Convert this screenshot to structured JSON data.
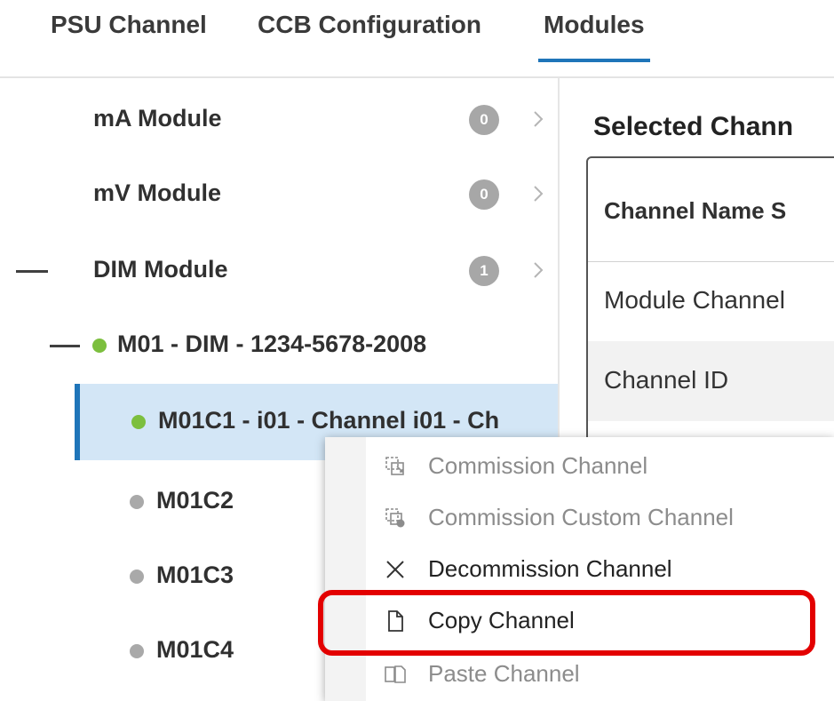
{
  "tabs": [
    {
      "label": "PSU Channel"
    },
    {
      "label": "CCB Configuration"
    },
    {
      "label": "Modules"
    }
  ],
  "active_tab": "Modules",
  "tree": {
    "modules": [
      {
        "label": "mA Module",
        "count": "0"
      },
      {
        "label": "mV Module",
        "count": "0"
      },
      {
        "label": "DIM Module",
        "count": "1"
      }
    ],
    "device": {
      "label": "M01 - DIM - 1234-5678-2008",
      "status": "online"
    },
    "channels": [
      {
        "label": "M01C1 - i01 - Channel i01 - Ch",
        "status": "online",
        "selected": true
      },
      {
        "label": "M01C2",
        "status": "inactive"
      },
      {
        "label": "M01C3",
        "status": "inactive"
      },
      {
        "label": "M01C4",
        "status": "inactive"
      }
    ]
  },
  "detail_panel": {
    "title": "Selected Chann",
    "header": "Channel Name S",
    "rows": [
      "Module Channel",
      "Channel ID"
    ]
  },
  "context_menu": {
    "items": [
      {
        "label": "Commission Channel",
        "icon": "commission-icon",
        "enabled": false
      },
      {
        "label": "Commission Custom Channel",
        "icon": "commission-custom-icon",
        "enabled": false
      },
      {
        "label": "Decommission Channel",
        "icon": "close-icon",
        "enabled": true
      },
      {
        "label": "Copy Channel",
        "icon": "copy-icon",
        "enabled": true,
        "highlighted": true
      },
      {
        "label": "Paste Channel",
        "icon": "paste-icon",
        "enabled": false
      }
    ]
  },
  "colors": {
    "accent": "#1f75b9",
    "status_online": "#7cbf3e",
    "status_inactive": "#a9a9a9",
    "selection_bg": "#d3e6f6",
    "highlight": "#e30000"
  }
}
